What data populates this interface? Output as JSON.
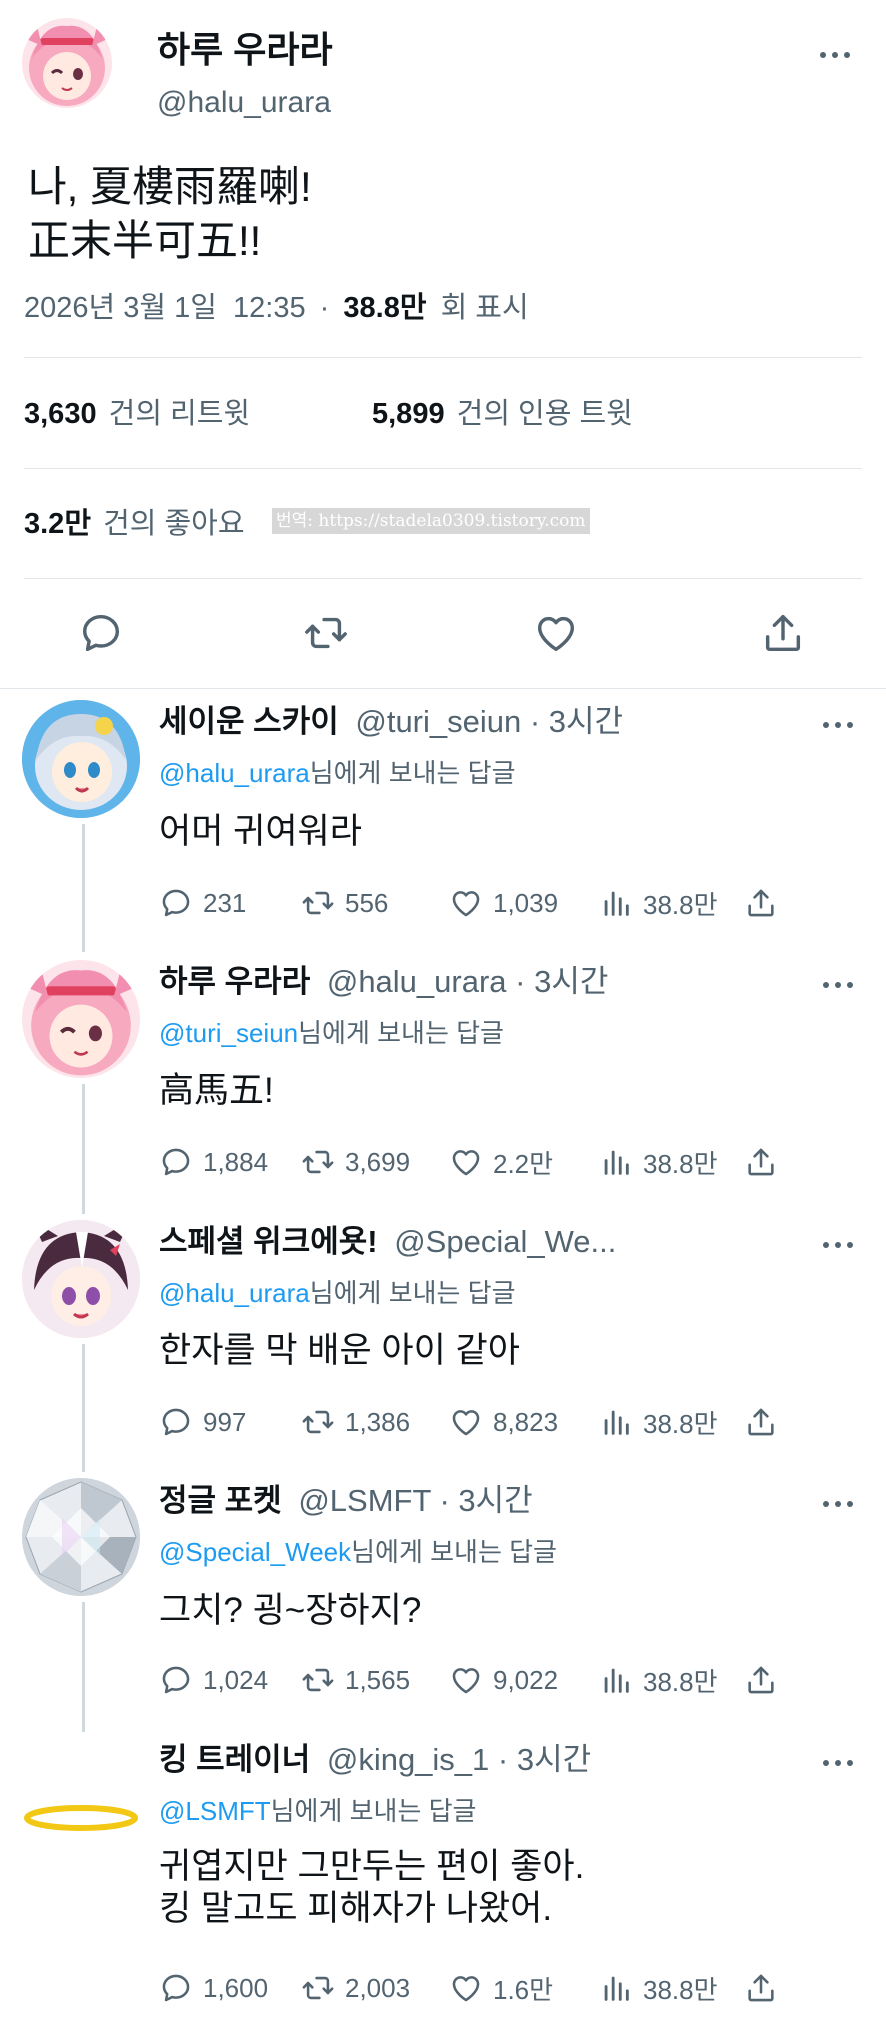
{
  "main_tweet": {
    "display_name": "하루 우라라",
    "handle": "@halu_urara",
    "text_line1": "나, 夏樓雨羅喇!",
    "text_line2": "正末半可五!!",
    "date": "2026년 3월 1일",
    "time": "12:35",
    "separator": "·",
    "views_value": "38.8만",
    "views_label": "회 표시",
    "retweets_value": "3,630",
    "retweets_label": "건의 리트윗",
    "quotes_value": "5,899",
    "quotes_label": "건의 인용 트윗",
    "likes_value": "3.2만",
    "likes_label": "건의 좋아요",
    "watermark": "번역: https://stadela0309.tistory.com"
  },
  "replies": [
    {
      "display_name": "세이운 스카이",
      "meta": "@turi_seiun · 3시간",
      "reply_handle": "@halu_urara",
      "reply_suffix": "님에게 보내는 답글",
      "text": "어머 귀여워라",
      "replies": "231",
      "retweets": "556",
      "likes": "1,039",
      "views": "38.8만"
    },
    {
      "display_name": "하루 우라라",
      "meta": "@halu_urara · 3시간",
      "reply_handle": "@turi_seiun",
      "reply_suffix": "님에게 보내는 답글",
      "text": "高馬五!",
      "replies": "1,884",
      "retweets": "3,699",
      "likes": "2.2만",
      "views": "38.8만"
    },
    {
      "display_name": "스페셜 위크에욧!",
      "meta": "@Special_We...",
      "reply_handle": "@halu_urara",
      "reply_suffix": "님에게 보내는 답글",
      "text": "한자를 막 배운 아이 같아",
      "replies": "997",
      "retweets": "1,386",
      "likes": "8,823",
      "views": "38.8만"
    },
    {
      "display_name": "정글 포켓",
      "meta": "@LSMFT · 3시간",
      "reply_handle": "@Special_Week",
      "reply_suffix": "님에게 보내는 답글",
      "text": "그치? 굉~장하지?",
      "replies": "1,024",
      "retweets": "1,565",
      "likes": "9,022",
      "views": "38.8만"
    },
    {
      "display_name": "킹 트레이너",
      "meta": "@king_is_1 · 3시간",
      "reply_handle": "@LSMFT",
      "reply_suffix": "님에게 보내는 답글",
      "text": "귀엽지만 그만두는 편이 좋아.\n킹 말고도 피해자가 나왔어.",
      "replies": "1,600",
      "retweets": "2,003",
      "likes": "1.6만",
      "views": "38.8만"
    }
  ],
  "colors": {
    "link": "#1d9bf0",
    "muted": "#536471",
    "text": "#0f1419",
    "divider": "#e1e6ea"
  },
  "icons": [
    "reply-icon",
    "retweet-icon",
    "like-icon",
    "share-icon",
    "views-icon",
    "more-icon"
  ]
}
